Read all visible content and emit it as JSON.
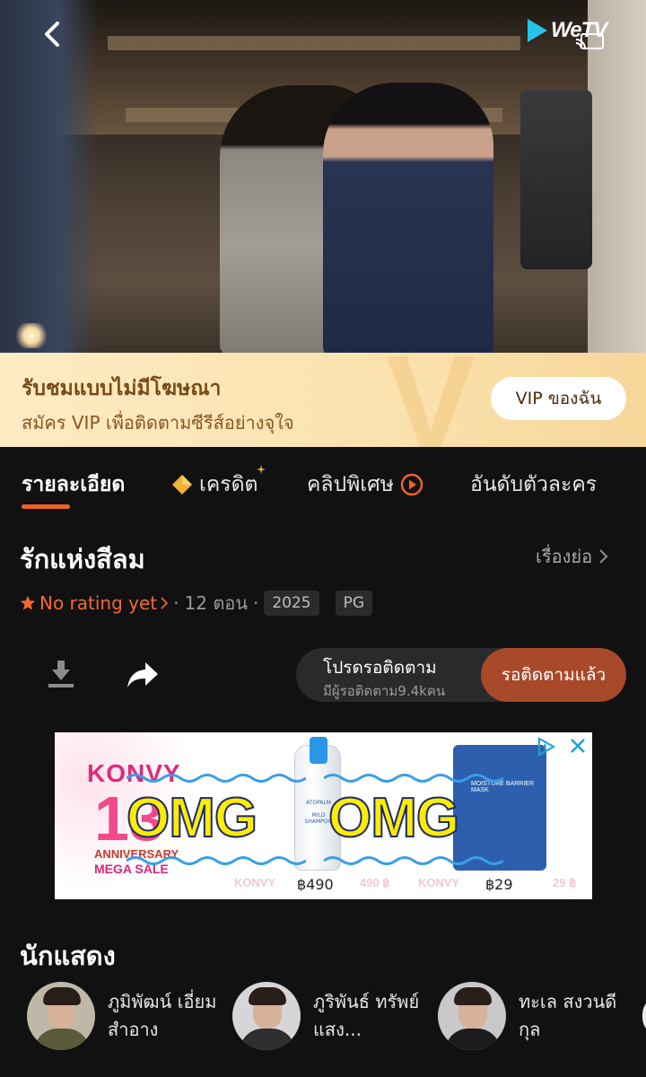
{
  "hero": {
    "logo_text": "WeTV"
  },
  "vip_banner": {
    "title": "รับชมแบบไม่มีโฆษณา",
    "subtitle": "สมัคร VIP เพื่อติดตามซีรีส์อย่างจุใจ",
    "button": "VIP ของฉัน"
  },
  "tabs": [
    {
      "label": "รายละเอียด",
      "active": true
    },
    {
      "label": "เครดิต"
    },
    {
      "label": "คลิปพิเศษ"
    },
    {
      "label": "อันดับตัวละคร"
    }
  ],
  "details": {
    "title": "รักแห่งสีลม",
    "synopsis_link": "เรื่องย่อ",
    "rating": "No rating yet",
    "episodes": "12 ตอน",
    "year": "2025",
    "age_rating": "PG"
  },
  "follow": {
    "status": "โปรดรอติดตาม",
    "followers": "มีผู้รอติดตาม9.4kคน",
    "button": "รอติดตามแล้ว"
  },
  "ad": {
    "brand": "KONVY",
    "number": "13",
    "anniversary": "ANNIVERSARY",
    "mega_sale": "MEGA SALE",
    "overlay_text": "OMG",
    "product1_brand": "ATOPALM",
    "product1_label": "MILD SHAMPOO",
    "product1_price": "฿490",
    "product2_label": "MOISTURE BARRIER MASK",
    "product2_price": "฿29",
    "ghost1": "KONVY",
    "ghost1_price": "490 ฿",
    "ghost2": "KONVY",
    "ghost2_price": "29 ฿"
  },
  "cast": {
    "title": "นักแสดง",
    "actors": [
      {
        "name": "ภูมิพัฒน์ เอี่ยมสำอาง",
        "jacket": "#5a5a3a"
      },
      {
        "name": "ภูริพันธ์ ทรัพย์แสง...",
        "jacket": "#2e2e30"
      },
      {
        "name": "ทะเล สงวนดีกุล",
        "jacket": "#1c1c1e"
      }
    ]
  },
  "colors": {
    "accent": "#f0602a",
    "follow_button": "#a8492a",
    "vip_text": "#7a4a16"
  }
}
